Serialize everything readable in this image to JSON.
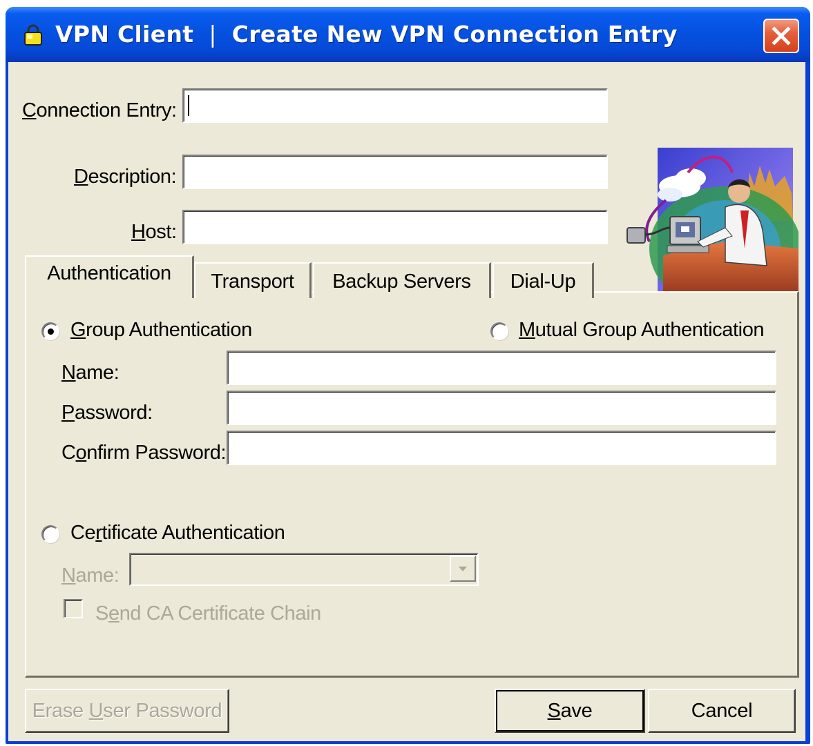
{
  "window": {
    "app_name": "VPN Client",
    "separator": "|",
    "title": "Create New VPN Connection Entry",
    "close_icon": "close-x-icon",
    "app_icon": "padlock-icon",
    "titlebar_color": "#0a3fd6",
    "close_color": "#e5603b"
  },
  "form": {
    "connection_entry": {
      "label": "Connection Entry:",
      "mnemonic": "C",
      "value": ""
    },
    "description": {
      "label": "Description:",
      "mnemonic": "D",
      "value": ""
    },
    "host": {
      "label": "Host:",
      "mnemonic": "H",
      "value": ""
    }
  },
  "illustration": {
    "icon": "man-at-computer-network-illustration"
  },
  "tabs": [
    {
      "label": "Authentication",
      "active": true
    },
    {
      "label": "Transport",
      "active": false
    },
    {
      "label": "Backup Servers",
      "active": false
    },
    {
      "label": "Dial-Up",
      "active": false
    }
  ],
  "auth": {
    "group_auth": {
      "label": "Group Authentication",
      "mnemonic": "G",
      "selected": true
    },
    "mutual_group_auth": {
      "label": "Mutual Group Authentication",
      "mnemonic": "M",
      "selected": false
    },
    "name": {
      "label": "Name:",
      "mnemonic": "N",
      "value": ""
    },
    "password": {
      "label": "Password:",
      "mnemonic": "P",
      "value": ""
    },
    "confirm_password": {
      "label": "Confirm Password:",
      "mnemonic": "o",
      "value": ""
    },
    "cert_auth": {
      "label": "Certificate Authentication",
      "mnemonic": "r",
      "selected": false
    },
    "cert_name": {
      "label": "Name:",
      "mnemonic": "N",
      "value": "",
      "disabled": true
    },
    "send_ca_chain": {
      "label": "Send CA Certificate Chain",
      "mnemonic": "e",
      "checked": false,
      "disabled": true
    }
  },
  "buttons": {
    "erase": {
      "label": "Erase User Password",
      "mnemonic": "U",
      "disabled": true
    },
    "save": {
      "label": "Save",
      "mnemonic": "S"
    },
    "cancel": {
      "label": "Cancel"
    }
  }
}
